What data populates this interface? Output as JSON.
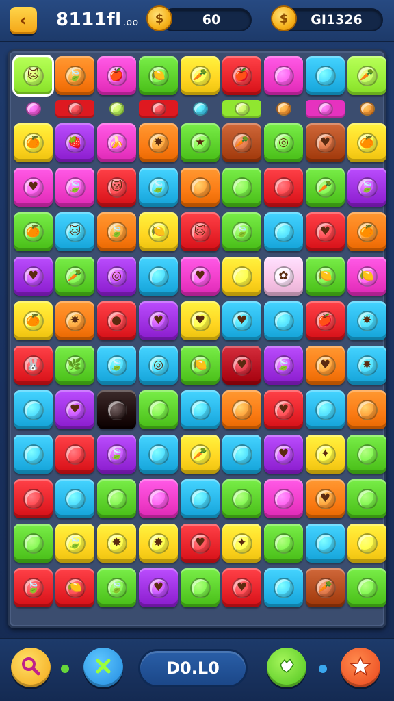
{
  "header": {
    "back_icon": "chevron-left-icon",
    "title": "8111fl",
    "title_suffix": ".oo",
    "coins_icon": "gold-coin-icon",
    "coins_value": "60",
    "gems_icon": "gold-coin-icon",
    "gems_value": "GI1326"
  },
  "board": {
    "rows": 12,
    "cols": 9,
    "color_palette": {
      "red": "#e8232a",
      "orange": "#fb7b14",
      "yellow": "#ffd521",
      "green": "#5bd02a",
      "blue": "#27b6ea",
      "purple": "#9d2fe0",
      "magenta": "#f03cc9",
      "brown": "#b24a1c",
      "lime": "#9af03a",
      "pink": "#f8c3e6",
      "dark": "#1e0d0d",
      "darkred": "#b7101f"
    },
    "gem_row": [
      "magenta",
      "red",
      "lime",
      "red",
      "blue",
      "lime",
      "orange",
      "magenta",
      "orange"
    ],
    "tiles": [
      [
        "lime",
        "orange",
        "magenta",
        "green",
        "yellow",
        "red",
        "magenta",
        "blue",
        "lime"
      ],
      [
        "yellow",
        "purple",
        "magenta",
        "orange",
        "green",
        "brown",
        "green",
        "brown",
        "yellow"
      ],
      [
        "magenta",
        "magenta",
        "red",
        "blue",
        "orange",
        "green",
        "red",
        "green",
        "purple"
      ],
      [
        "green",
        "blue",
        "orange",
        "yellow",
        "red",
        "green",
        "blue",
        "red",
        "orange"
      ],
      [
        "purple",
        "green",
        "purple",
        "blue",
        "magenta",
        "yellow",
        "pink",
        "green",
        "magenta"
      ],
      [
        "yellow",
        "orange",
        "red",
        "purple",
        "yellow",
        "blue",
        "blue",
        "red",
        "blue"
      ],
      [
        "red",
        "green",
        "blue",
        "blue",
        "green",
        "darkred",
        "purple",
        "orange",
        "blue"
      ],
      [
        "blue",
        "purple",
        "dark",
        "green",
        "blue",
        "orange",
        "red",
        "blue",
        "orange"
      ],
      [
        "blue",
        "red",
        "purple",
        "blue",
        "yellow",
        "blue",
        "purple",
        "yellow",
        "green"
      ],
      [
        "red",
        "blue",
        "green",
        "magenta",
        "blue",
        "green",
        "magenta",
        "orange",
        "green"
      ],
      [
        "green",
        "yellow",
        "yellow",
        "yellow",
        "red",
        "yellow",
        "green",
        "blue",
        "yellow"
      ],
      [
        "red",
        "red",
        "green",
        "purple",
        "green",
        "red",
        "blue",
        "brown",
        "green"
      ]
    ],
    "figures": [
      [
        "cat-face-icon",
        "leaf-icon",
        "apple-icon",
        "lemon-icon",
        "carrot-icon",
        "apple-icon",
        "ball-icon",
        "bubble-icon",
        "carrot-icon"
      ],
      [
        "orange-fruit-icon",
        "strawberry-icon",
        "banana-icon",
        "splash-icon",
        "star-icon",
        "carrot-icon",
        "swirl-icon",
        "heart-icon",
        "orange-fruit-icon"
      ],
      [
        "heart-icon",
        "leaf-icon",
        "cat-face-icon",
        "leaf-icon",
        "ball-icon",
        "ball-icon",
        "ball-icon",
        "carrot-icon",
        "leaf-icon"
      ],
      [
        "orange-fruit-icon",
        "cat-face-icon",
        "leaf-icon",
        "lemon-icon",
        "cat-face-icon",
        "leaf-icon",
        "ball-icon",
        "heart-icon",
        "orange-fruit-icon"
      ],
      [
        "heart-icon",
        "carrot-icon",
        "swirl-icon",
        "bubble-icon",
        "heart-icon",
        "ball-icon",
        "flower-icon",
        "lemon-icon",
        "lemon-icon"
      ],
      [
        "orange-fruit-icon",
        "splash-icon",
        "egg-icon",
        "heart-icon",
        "heart-icon",
        "heart-icon",
        "ball-icon",
        "apple-icon",
        "splash-icon"
      ],
      [
        "rabbit-face-icon",
        "herb-icon",
        "leaf-icon",
        "swirl-icon",
        "lemon-icon",
        "heart-icon",
        "leaf-icon",
        "heart-icon",
        "splash-icon"
      ],
      [
        "bubble-icon",
        "heart-icon",
        "ball-icon",
        "ball-icon",
        "bubble-icon",
        "ball-icon",
        "heart-icon",
        "bubble-icon",
        "ball-icon"
      ],
      [
        "ball-icon",
        "ball-icon",
        "leaf-icon",
        "ball-icon",
        "carrot-icon",
        "ball-icon",
        "heart-icon",
        "candy-icon",
        "bubble-icon"
      ],
      [
        "ball-icon",
        "bubble-icon",
        "bubble-icon",
        "ball-icon",
        "bubble-icon",
        "ball-icon",
        "ball-icon",
        "heart-icon",
        "ball-icon"
      ],
      [
        "bubble-icon",
        "leaf-icon",
        "splash-icon",
        "splash-icon",
        "heart-icon",
        "candy-icon",
        "ball-icon",
        "ball-icon",
        "ball-icon"
      ],
      [
        "leaf-icon",
        "lemon-icon",
        "leaf-icon",
        "heart-icon",
        "ball-icon",
        "heart-icon",
        "ball-icon",
        "carrot-icon",
        "ball-icon"
      ]
    ],
    "selected": [
      0,
      0
    ]
  },
  "footer": {
    "search_icon": "magnifier-icon",
    "cancel_icon": "close-x-icon",
    "score_text": "D0.L0",
    "ok_icon": "puzzle-icon",
    "star_icon": "star-icon"
  }
}
